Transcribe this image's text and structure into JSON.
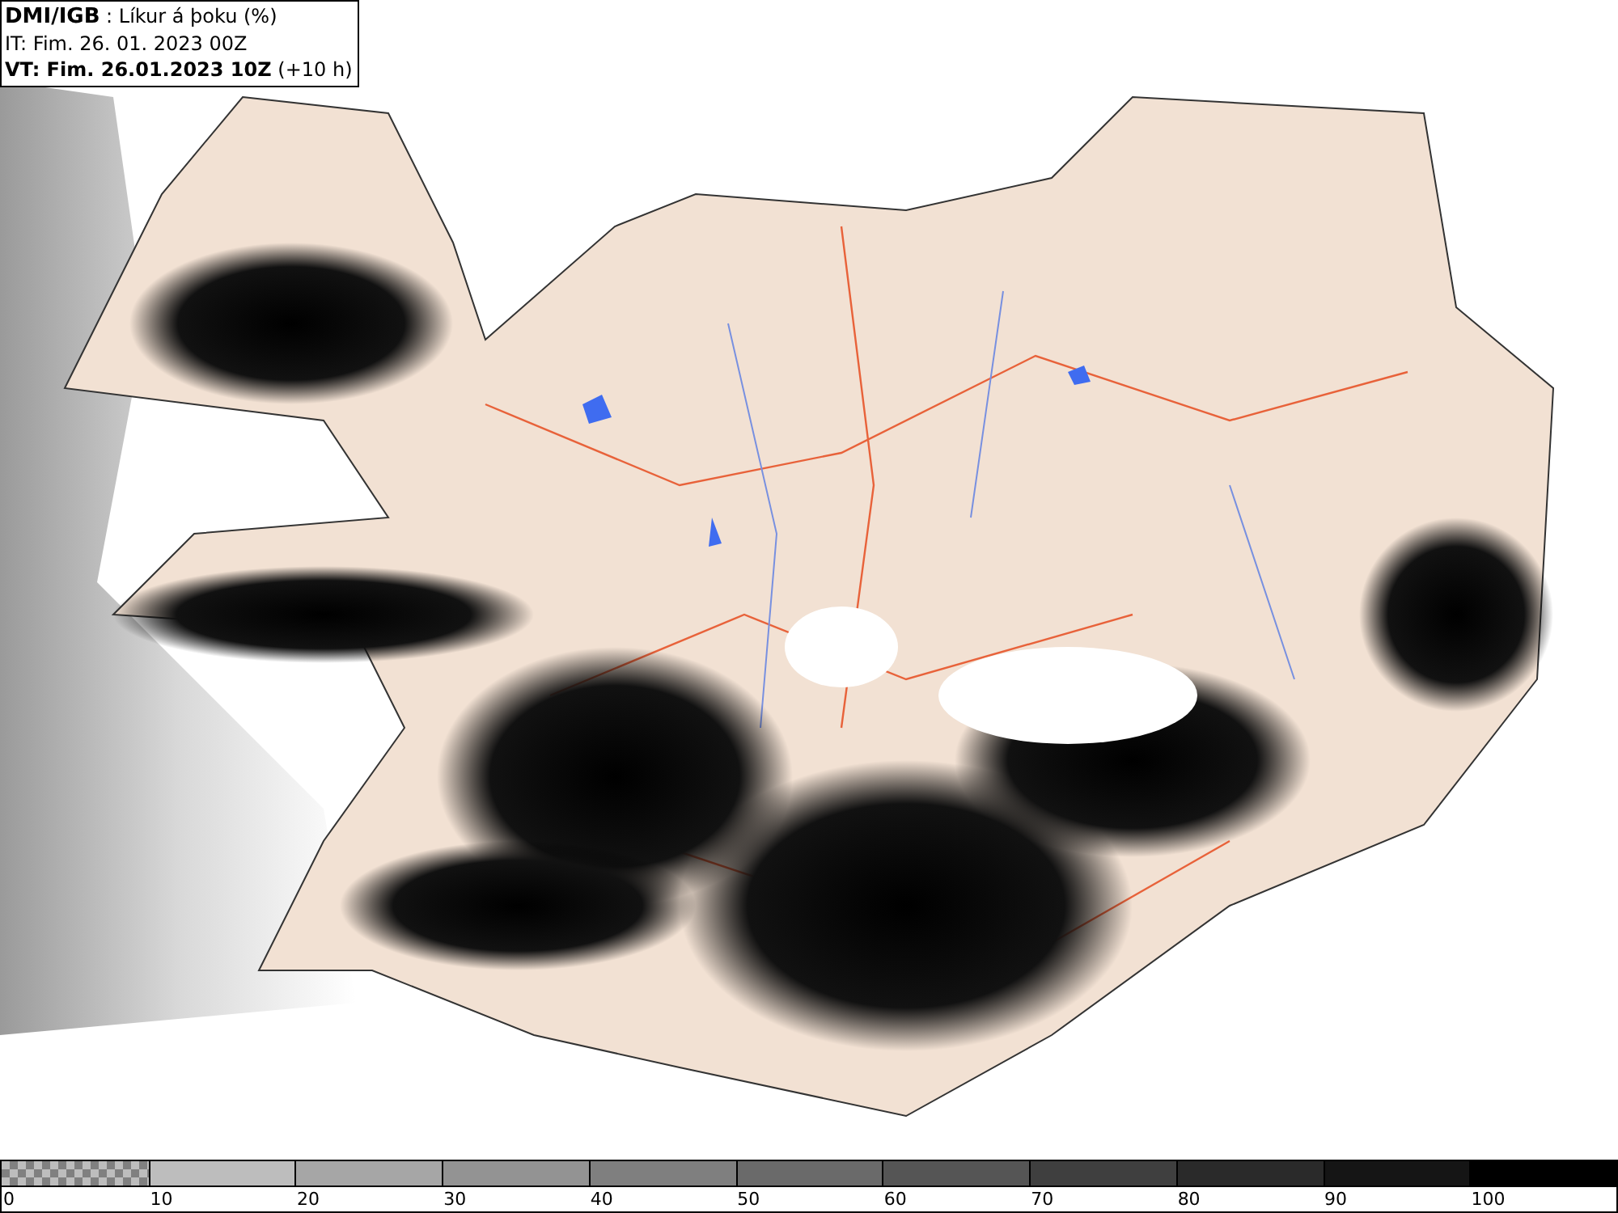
{
  "title_box": {
    "lines": [
      "**DMI/IGB** : Líkur á þoku (%)",
      "IT: Fim. 26. 01. 2023 00Z",
      "**VT: Fim. 26.01.2023 10Z** (+10 h)"
    ]
  },
  "legend": {
    "segments": [
      {
        "kind": "checker",
        "color": "#808080",
        "label": "0"
      },
      {
        "kind": "solid",
        "color": "#bdbdbd",
        "label": "10"
      },
      {
        "kind": "solid",
        "color": "#a6a6a6",
        "label": "20"
      },
      {
        "kind": "solid",
        "color": "#939393",
        "label": "30"
      },
      {
        "kind": "solid",
        "color": "#7f7f7f",
        "label": "40"
      },
      {
        "kind": "solid",
        "color": "#6a6a6a",
        "label": "50"
      },
      {
        "kind": "solid",
        "color": "#555555",
        "label": "60"
      },
      {
        "kind": "solid",
        "color": "#3f3f3f",
        "label": "70"
      },
      {
        "kind": "solid",
        "color": "#2a2a2a",
        "label": "80"
      },
      {
        "kind": "solid",
        "color": "#151515",
        "label": "90"
      },
      {
        "kind": "solid",
        "color": "#000000",
        "label": "100"
      }
    ]
  }
}
